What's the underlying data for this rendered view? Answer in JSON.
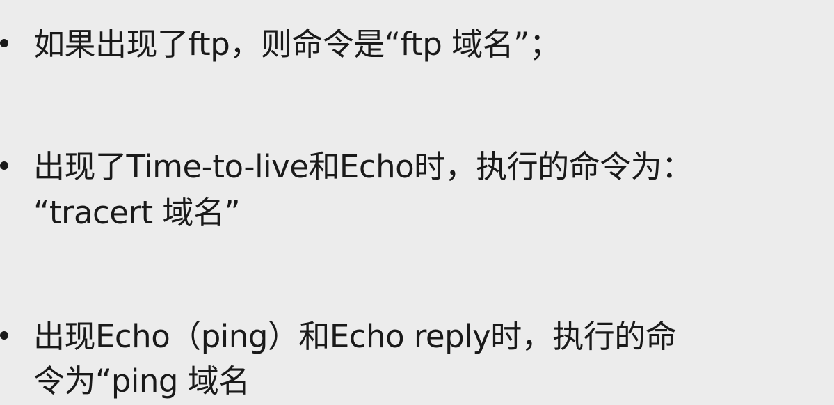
{
  "bullets": [
    {
      "lines": [
        "如果出现了ftp，则命令是“ftp  域名”；"
      ]
    },
    {
      "lines": [
        "出现了Time-to-live和Echo时，执行的命令为：",
        "“tracert 域名”"
      ]
    },
    {
      "lines": [
        "出现Echo（ping）和Echo reply时，执行的命",
        "令为“ping 域名"
      ]
    }
  ]
}
